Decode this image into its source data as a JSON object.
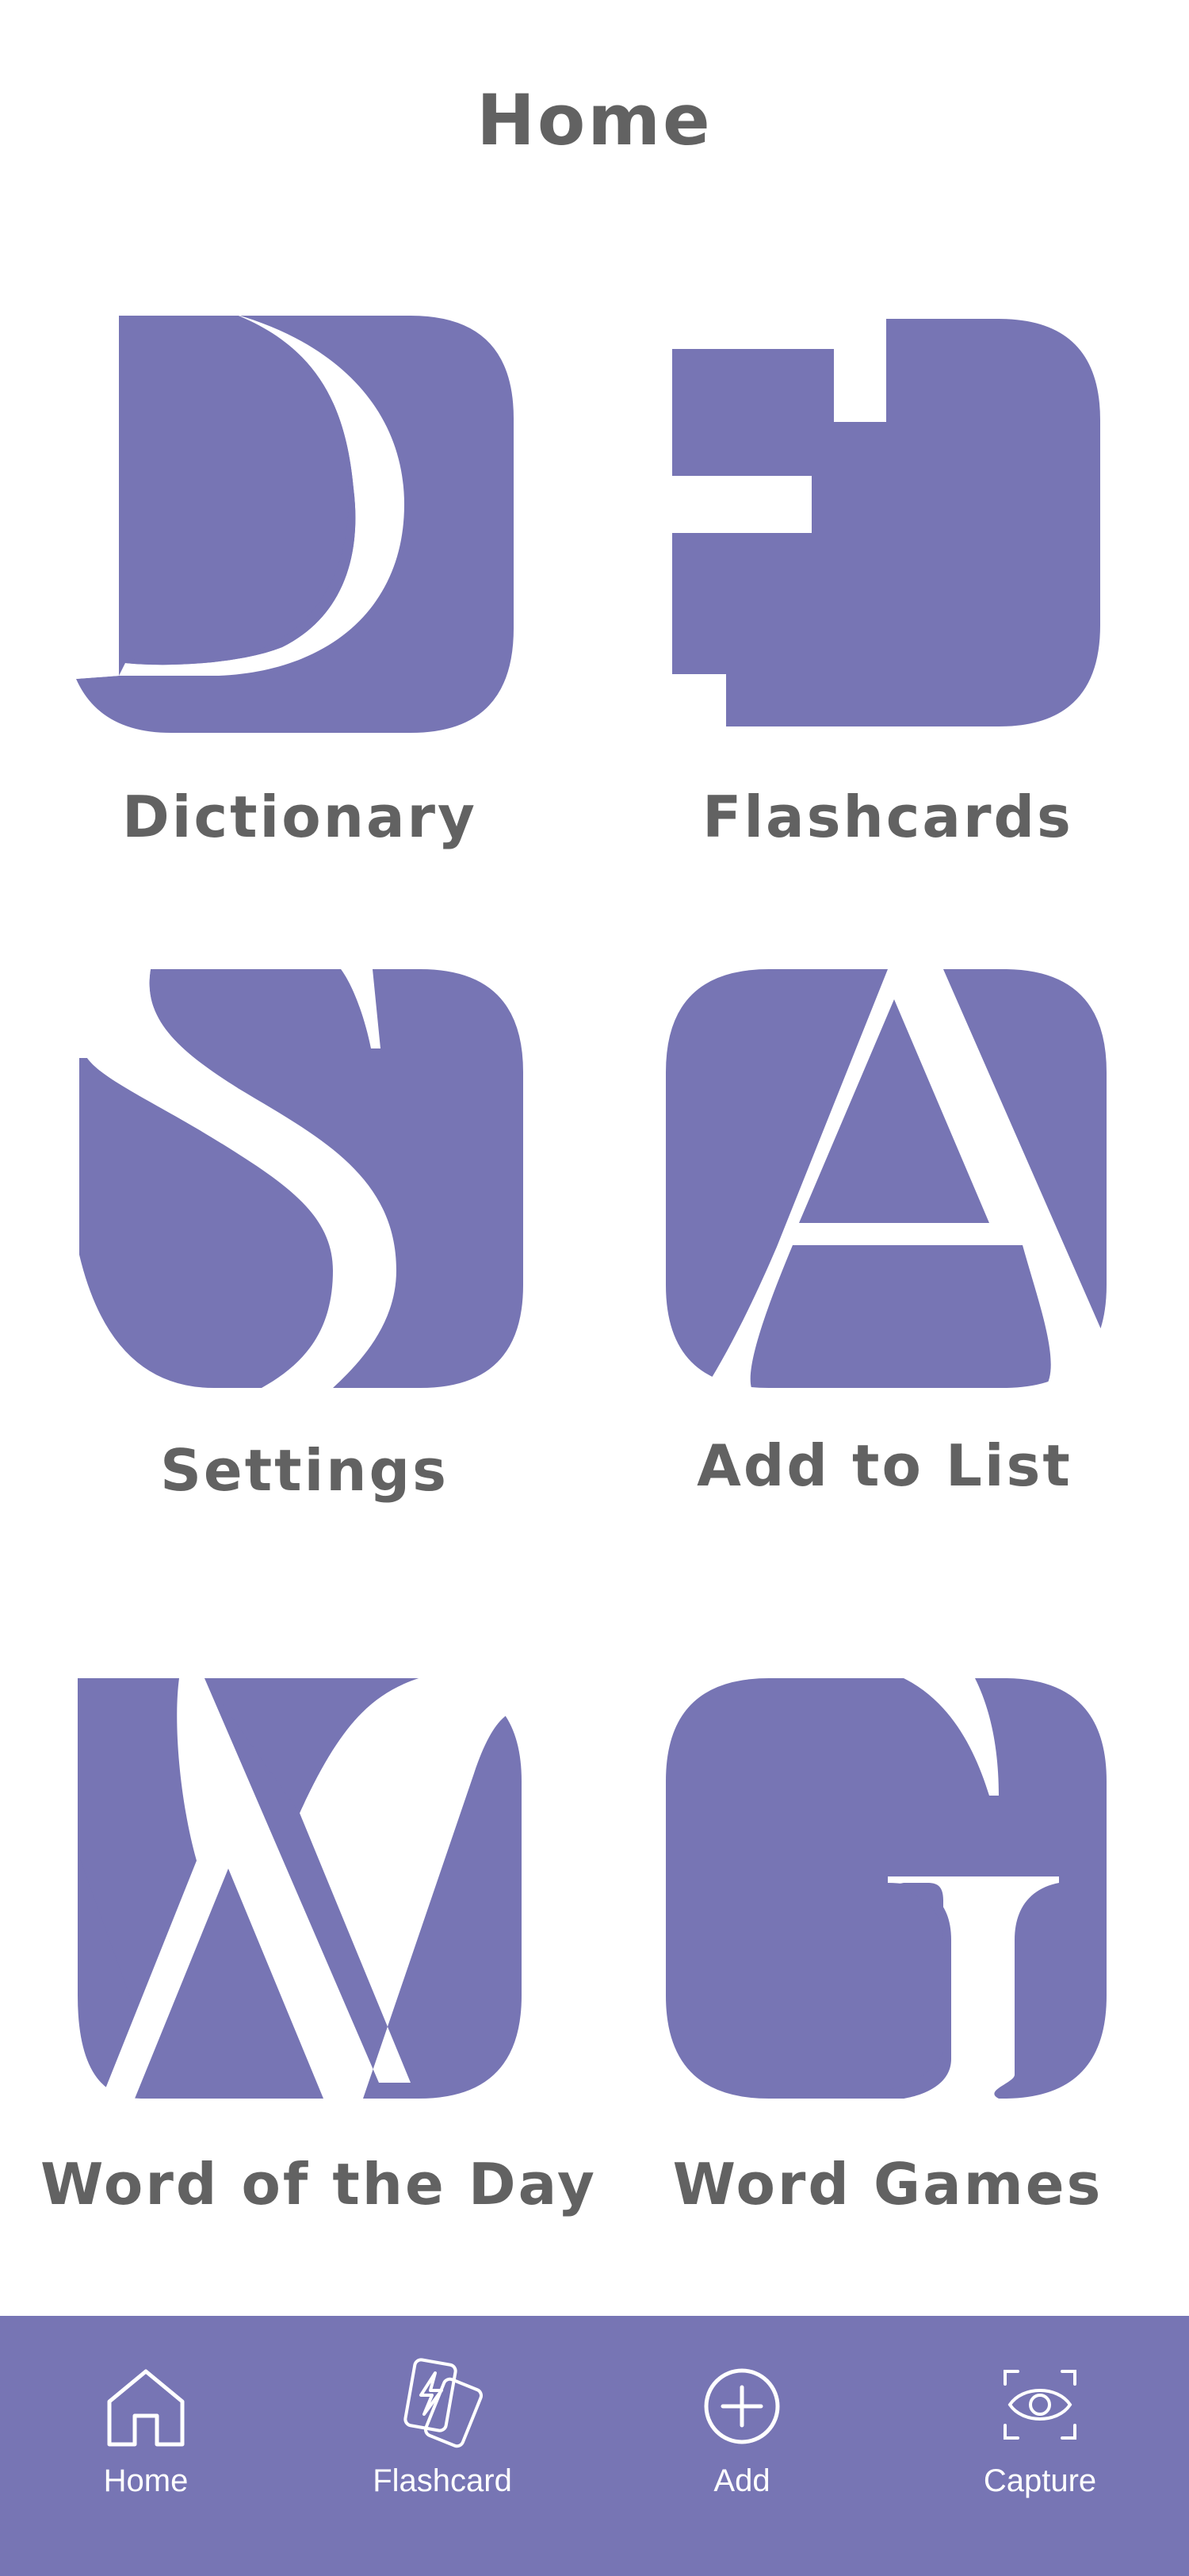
{
  "header": {
    "title": "Home"
  },
  "colors": {
    "accent": "#7775b4",
    "text": "#626262",
    "background": "#ffffff"
  },
  "tiles": [
    {
      "label": "Dictionary",
      "icon": "letter-d-icon",
      "letter": "D"
    },
    {
      "label": "Flashcards",
      "icon": "letter-f-icon",
      "letter": "F"
    },
    {
      "label": "Settings",
      "icon": "letter-s-icon",
      "letter": "S"
    },
    {
      "label": "Add to List",
      "icon": "letter-a-icon",
      "letter": "A"
    },
    {
      "label": "Word of the Day",
      "icon": "letter-w-icon",
      "letter": "W"
    },
    {
      "label": "Word Games",
      "icon": "letter-g-icon",
      "letter": "G"
    }
  ],
  "tabbar": {
    "items": [
      {
        "label": "Home",
        "icon": "home-icon"
      },
      {
        "label": "Flashcard",
        "icon": "flashcard-icon"
      },
      {
        "label": "Add",
        "icon": "plus-circle-icon"
      },
      {
        "label": "Capture",
        "icon": "eye-scan-icon"
      }
    ]
  }
}
